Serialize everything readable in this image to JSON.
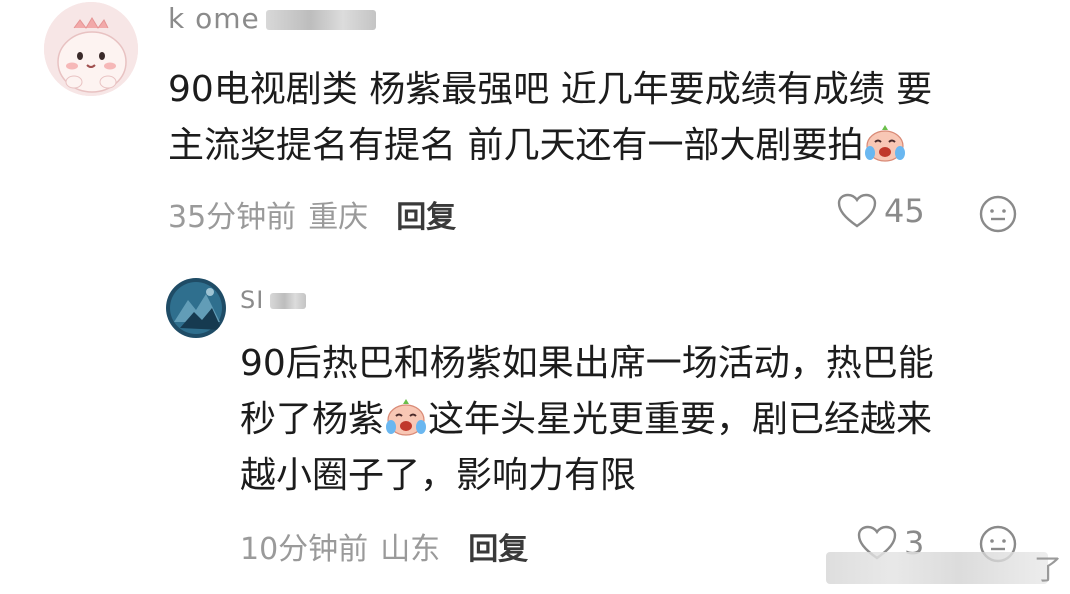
{
  "comments": [
    {
      "username": "k ome",
      "text_line1": "90电视剧类 杨紫最强吧 近几年要成绩有成绩 要",
      "text_line2": "主流奖提名有提名 前几天还有一部大剧要拍",
      "time": "35分钟前",
      "location": "重庆",
      "reply_label": "回复",
      "likes": "45",
      "emoji": "crying-laughing-face"
    },
    {
      "username": "SI",
      "text_line1": "90后热巴和杨紫如果出席一场活动，热巴能",
      "text_line2a": "秒了杨紫",
      "text_line2b": "这年头星光更重要，剧已经越来",
      "text_line3": "越小圈子了，影响力有限",
      "time": "10分钟前",
      "location": "山东",
      "reply_label": "回复",
      "likes": "3",
      "emoji": "crying-laughing-face"
    }
  ],
  "watermark_char": "了",
  "colors": {
    "text": "#1c1c1c",
    "meta": "#9a9a9a",
    "reply": "#3a3a3a",
    "avatar1_bg": "#f6e3e3",
    "avatar2_bg": "#2d5f7a"
  }
}
